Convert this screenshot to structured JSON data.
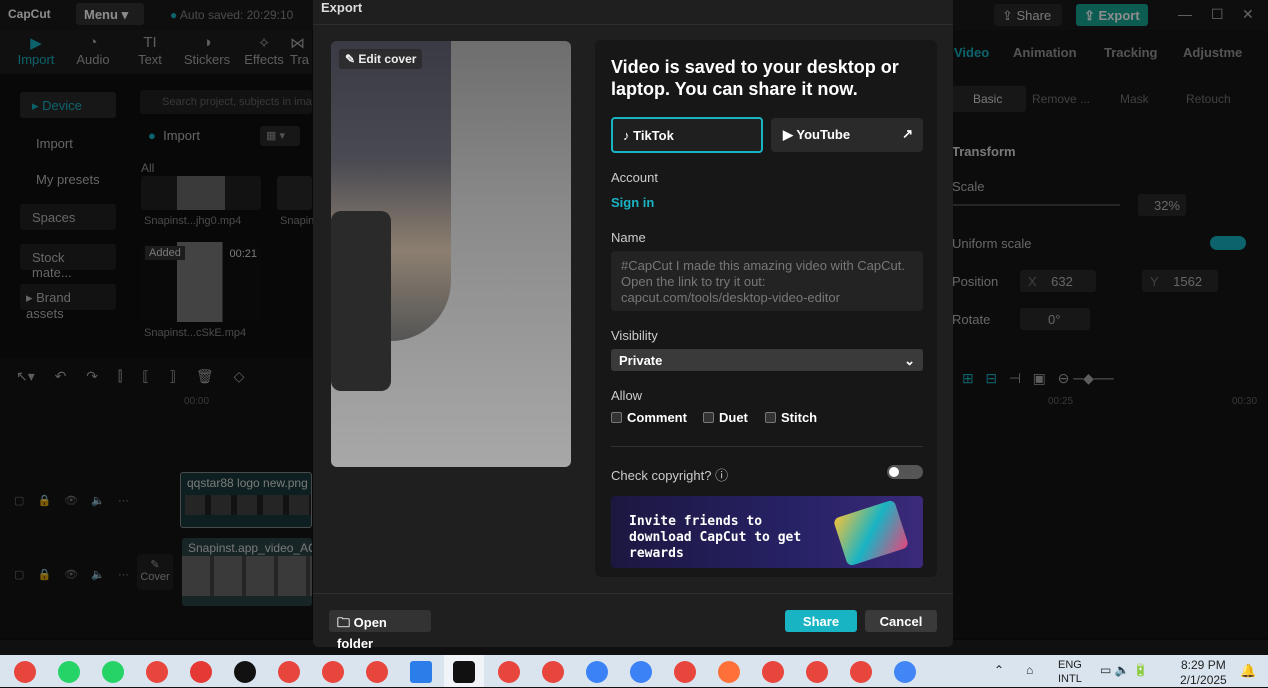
{
  "app": {
    "logo": "CapCut",
    "menu_label": "Menu",
    "autosave": "Auto saved: 20:29:10",
    "share_label": "Share",
    "export_label": "Export"
  },
  "toolbar": [
    {
      "label": "Import",
      "icon": "import-icon"
    },
    {
      "label": "Audio",
      "icon": "audio-icon"
    },
    {
      "label": "Text",
      "icon": "text-icon"
    },
    {
      "label": "Stickers",
      "icon": "stickers-icon"
    },
    {
      "label": "Effects",
      "icon": "effects-icon"
    },
    {
      "label": "Tra",
      "icon": "transitions-icon"
    }
  ],
  "leftnav": [
    "Device",
    "Import",
    "My presets",
    "Spaces",
    "Stock mate...",
    "Brand assets"
  ],
  "media": {
    "search_placeholder": "Search project, subjects in ima",
    "import_label": "Import",
    "all_label": "All",
    "file1": "Snapinst...jhg0.mp4",
    "file2": "Snapin",
    "added": "Added",
    "duration": "00:21",
    "file3": "Snapinst...cSkE.mp4"
  },
  "timeline": {
    "t0": "00:00",
    "clip1": "qqstar88 logo new.png",
    "clip2": "Snapinst.app_video_AQ",
    "cover": "Cover",
    "t25": "00:25",
    "t30": "00:30"
  },
  "rightpanel": {
    "tabs": [
      "Video",
      "Animation",
      "Tracking",
      "Adjustme"
    ],
    "subtabs": [
      "Basic",
      "Remove ...",
      "Mask",
      "Retouch"
    ],
    "transform": "Transform",
    "scale": "Scale",
    "scale_value": "32%",
    "uniform": "Uniform scale",
    "position": "Position",
    "x_label": "X",
    "x_value": "632",
    "y_label": "Y",
    "y_value": "1562",
    "rotate": "Rotate",
    "rotate_value": "0°"
  },
  "dialog": {
    "title": "Export",
    "edit_cover": "Edit cover",
    "headline": "Video is saved to your desktop or laptop. You can share it now.",
    "tiktok": "TikTok",
    "youtube": "YouTube",
    "account_label": "Account",
    "sign_in": "Sign in",
    "name_label": "Name",
    "name_placeholder": "#CapCut I made this amazing video with CapCut. Open the link to try it out: capcut.com/tools/desktop-video-editor",
    "visibility_label": "Visibility",
    "visibility_value": "Private",
    "allow_label": "Allow",
    "allow_options": [
      "Comment",
      "Duet",
      "Stitch"
    ],
    "copyright_label": "Check copyright?",
    "copyright_enabled": false,
    "banner_text": "Invite friends to download CapCut to get rewards",
    "open_folder": "Open folder",
    "share": "Share",
    "cancel": "Cancel"
  },
  "taskbar": {
    "lang1": "ENG",
    "lang2": "INTL",
    "time": "8:29 PM",
    "date": "2/1/2025"
  },
  "colors": {
    "accent": "#19b4c4",
    "export_green": "#18a896"
  }
}
